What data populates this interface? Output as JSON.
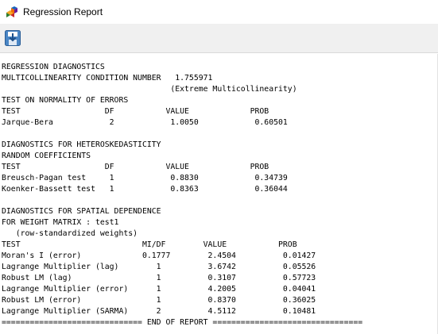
{
  "window": {
    "title": "Regression Report"
  },
  "icons": {
    "app": "geoda-cube-icon",
    "save": "save-report-icon"
  },
  "report": {
    "lines": [
      "REGRESSION DIAGNOSTICS",
      "MULTICOLLINEARITY CONDITION NUMBER   1.755971",
      "                                    (Extreme Multicollinearity)",
      "TEST ON NORMALITY OF ERRORS",
      "TEST                  DF           VALUE             PROB",
      "Jarque-Bera            2            1.0050            0.60501",
      "",
      "DIAGNOSTICS FOR HETEROSKEDASTICITY",
      "RANDOM COEFFICIENTS",
      "TEST                  DF           VALUE             PROB",
      "Breusch-Pagan test     1            0.8830            0.34739",
      "Koenker-Bassett test   1            0.8363            0.36044",
      "",
      "DIAGNOSTICS FOR SPATIAL DEPENDENCE",
      "FOR WEIGHT MATRIX : test1",
      "   (row-standardized weights)",
      "TEST                          MI/DF        VALUE           PROB",
      "Moran's I (error)             0.1777        2.4504          0.01427",
      "Lagrange Multiplier (lag)        1          3.6742          0.05526",
      "Robust LM (lag)                  1          0.3107          0.57723",
      "Lagrange Multiplier (error)      1          4.2005          0.04041",
      "Robust LM (error)                1          0.8370          0.36025",
      "Lagrange Multiplier (SARMA)      2          4.5112          0.10481",
      "============================== END OF REPORT ================================"
    ]
  }
}
